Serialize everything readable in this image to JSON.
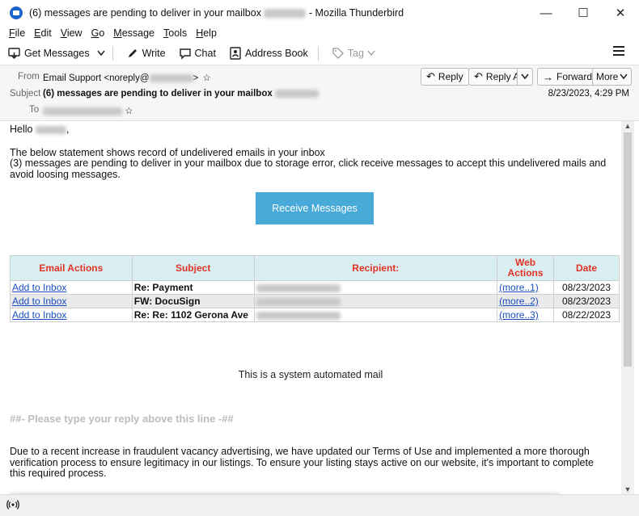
{
  "window": {
    "title_prefix": "(6) messages are pending to deliver in your mailbox",
    "title_suffix": "- Mozilla Thunderbird",
    "controls": {
      "minimize": "—",
      "maximize": "☐",
      "close": "✕"
    }
  },
  "menubar": {
    "items": [
      {
        "underline": "F",
        "rest": "ile"
      },
      {
        "underline": "E",
        "rest": "dit"
      },
      {
        "underline": "V",
        "rest": "iew"
      },
      {
        "underline": "G",
        "rest": "o"
      },
      {
        "underline": "M",
        "rest": "essage"
      },
      {
        "underline": "T",
        "rest": "ools"
      },
      {
        "underline": "H",
        "rest": "elp"
      }
    ]
  },
  "toolbar": {
    "get_messages": "Get Messages",
    "write": "Write",
    "chat": "Chat",
    "address_book": "Address Book",
    "tag": "Tag"
  },
  "header": {
    "from_label": "From",
    "from_value": "Email Support <noreply@",
    "from_end": ">",
    "subject_label": "Subject",
    "subject_value": "(6) messages are pending to deliver in your mailbox",
    "to_label": "To",
    "date": "8/23/2023, 4:29 PM",
    "buttons": {
      "reply": "Reply",
      "reply_all": "Reply All",
      "forward": "Forward",
      "more": "More"
    }
  },
  "body": {
    "greeting": "Hello",
    "greeting_end": ",",
    "line1": "The below statement shows record of undelivered emails in your inbox",
    "line2": "(3) messages are pending to deliver in your mailbox due to storage error, click receive messages to accept this undelivered mails and avoid loosing messages.",
    "button": "Receive Messages",
    "table": {
      "headers": [
        "Email Actions",
        "Subject",
        "Recipient:",
        "Web Actions",
        "Date"
      ],
      "rows": [
        {
          "action": "Add to Inbox",
          "subject": "Re: Payment",
          "web": "(more..1)",
          "date": "08/23/2023"
        },
        {
          "action": "Add to Inbox",
          "subject": "FW: DocuSign",
          "web": "(more..2)",
          "date": "08/23/2023"
        },
        {
          "action": "Add to Inbox",
          "subject": "Re: Re: 1102 Gerona Ave",
          "web": "(more..3)",
          "date": "08/22/2023"
        }
      ]
    },
    "automated": "This is a system automated mail",
    "reply_line": "##- Please type your reply above this line -##",
    "paragraph": "Due to a recent increase in fraudulent vacancy advertising, we have updated our Terms of Use and implemented a more thorough verification process to ensure legitimacy in our listings. To ensure your listing stays active on our website, it's important to complete this required process."
  },
  "colors": {
    "accent": "#48aad9",
    "header_red": "#e13326",
    "table_head_bg": "#d9eef0",
    "link": "#1a4fbf"
  }
}
